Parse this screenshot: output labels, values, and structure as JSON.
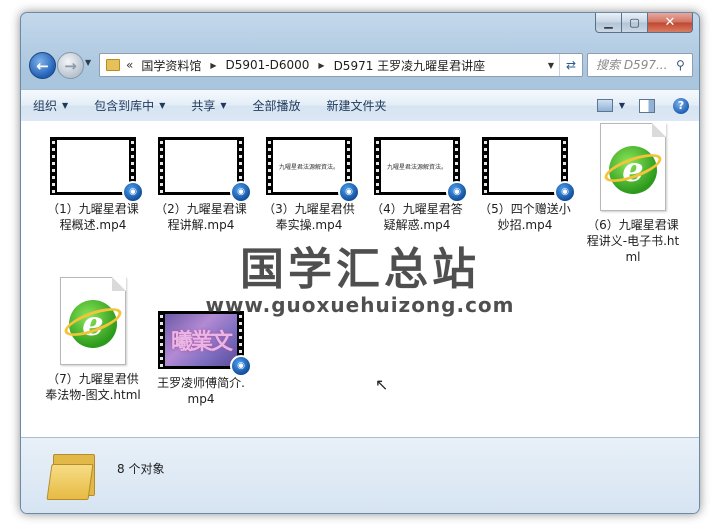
{
  "address": {
    "overflow": "«",
    "crumbs": [
      "国学资料馆",
      "D5901-D6000",
      "D5971 王罗凌九曜星君讲座"
    ]
  },
  "search": {
    "placeholder": "搜索 D597..."
  },
  "toolbar": {
    "organize": "组织",
    "include_library": "包含到库中",
    "share": "共享",
    "play_all": "全部播放",
    "new_folder": "新建文件夹"
  },
  "files": [
    {
      "name": "（1）九曜星君课程概述.mp4",
      "type": "video",
      "frame": "blank"
    },
    {
      "name": "（2）九曜星君课程讲解.mp4",
      "type": "video",
      "frame": "blank"
    },
    {
      "name": "（3）九曜星君供奉实操.mp4",
      "type": "video",
      "frame": "text",
      "frame_text": "九曜星君法源解資法。"
    },
    {
      "name": "（4）九曜星君答疑解惑.mp4",
      "type": "video",
      "frame": "text",
      "frame_text": "九曜星君法源解資法。"
    },
    {
      "name": "（5）四个赠送小妙招.mp4",
      "type": "video",
      "frame": "blank"
    },
    {
      "name": "（6）九曜星君课程讲义-电子书.html",
      "type": "html"
    },
    {
      "name": "（7）九曜星君供奉法物-图文.html",
      "type": "html"
    },
    {
      "name": "王罗凌师傅简介.mp4",
      "type": "video",
      "frame": "purple",
      "frame_text": "曦業文"
    }
  ],
  "watermark": {
    "title": "国学汇总站",
    "url": "www.guoxuehuizong.com"
  },
  "details": {
    "count": "8 个对象"
  },
  "colors": {
    "media_badge": "#1f5fb5",
    "ie_green": "#2d9a1c"
  }
}
